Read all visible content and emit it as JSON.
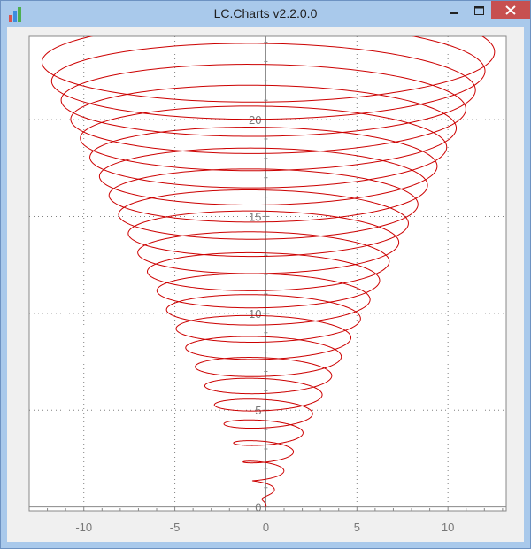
{
  "window": {
    "title": "LC.Charts v2.2.0.0",
    "icon": "bar-chart-app-icon",
    "buttons": [
      "minimize",
      "maximize",
      "close"
    ]
  },
  "colors": {
    "titlebar": "#a9c9eb",
    "close_button": "#c75050",
    "series": "#cc0000",
    "axis": "#888888",
    "grid": "#808080",
    "plot_background": "#ffffff"
  },
  "chart_data": {
    "type": "line",
    "title": "",
    "xlabel": "",
    "ylabel": "",
    "xlim": [
      -13,
      13.2
    ],
    "ylim": [
      -0.2,
      24.3
    ],
    "grid": true,
    "grid_style": "dotted",
    "x_ticks": [
      -10,
      -5,
      0,
      5,
      10
    ],
    "y_ticks": [
      0,
      5,
      10,
      15,
      20
    ],
    "x_tick_labels": [
      "-10",
      "-5",
      "0",
      "5",
      "10"
    ],
    "y_tick_labels": [
      "0",
      "5",
      "10",
      "15",
      "20"
    ],
    "series": [
      {
        "description_shape": "conical spiral (elliptical loops growing with height)",
        "loops": 24,
        "center_x": 0,
        "radius_x_per_unit_height": 0.535,
        "radius_y_per_unit_height": 0.1,
        "height_max": 23.6,
        "phase_deg": 45,
        "color": "#cc0000"
      }
    ]
  }
}
